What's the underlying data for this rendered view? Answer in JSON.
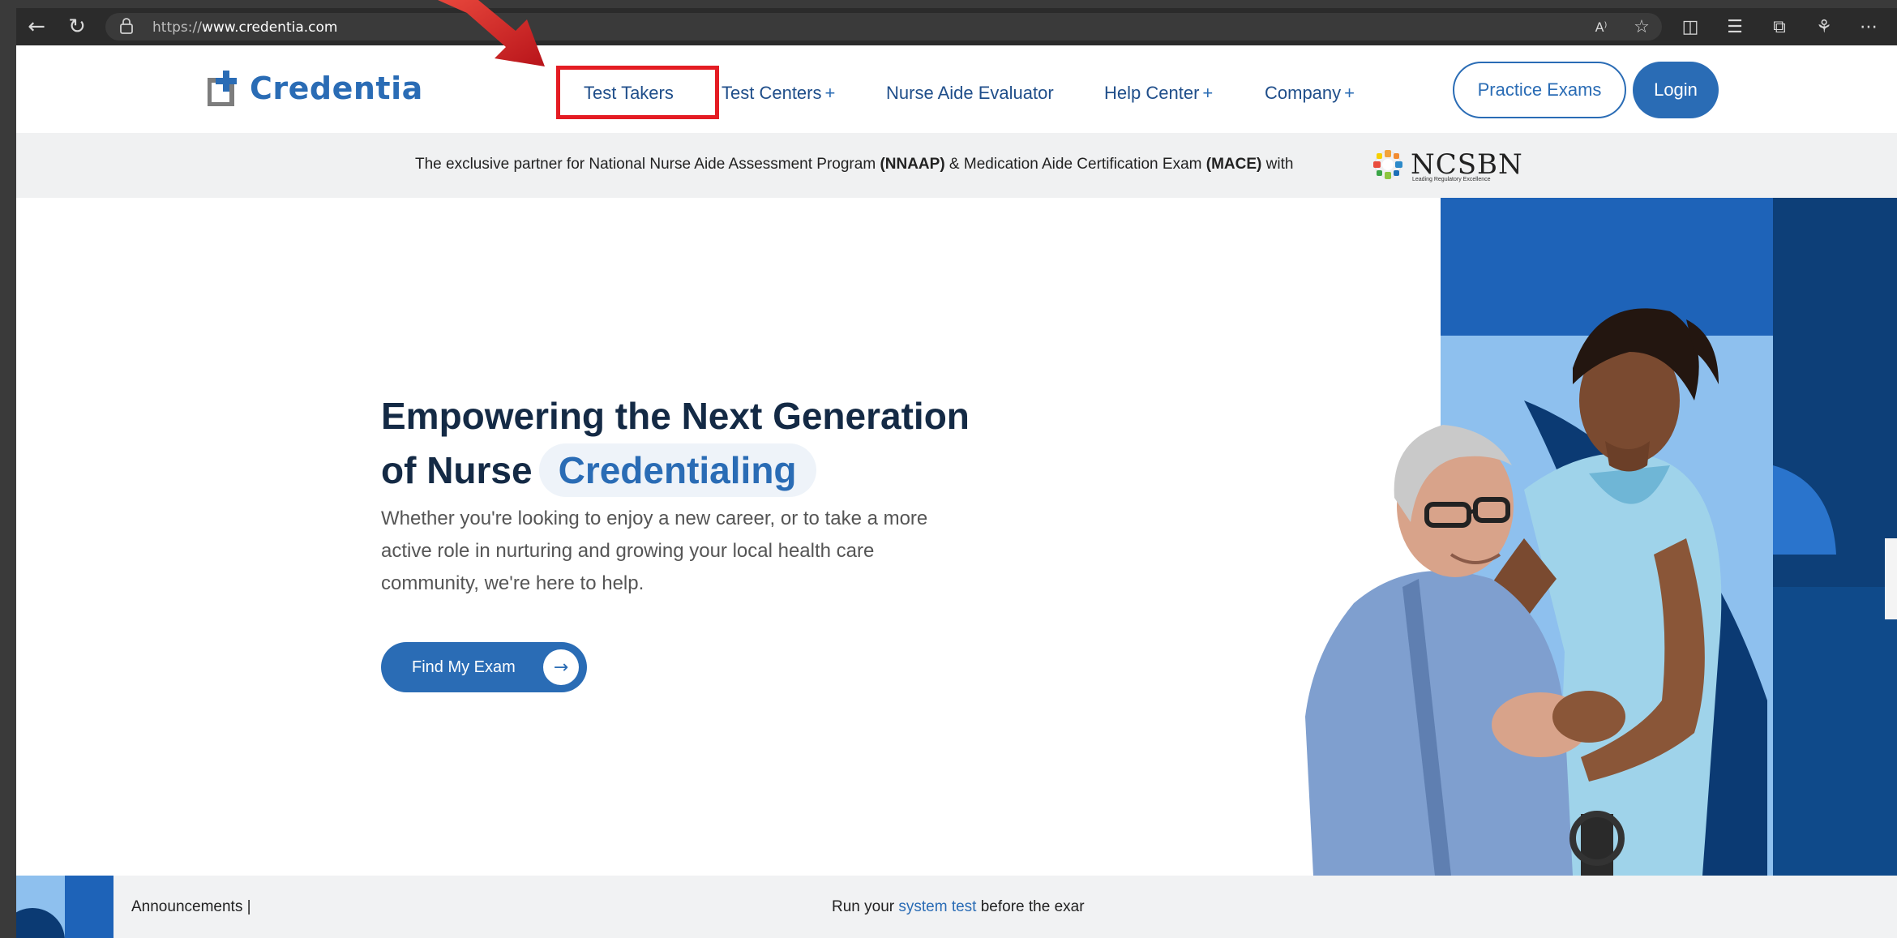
{
  "browser": {
    "url_scheme": "https://",
    "url_host": "www.credentia.com",
    "reader_label": "A⁾"
  },
  "site": {
    "logo_text": "Credentia",
    "nav": [
      {
        "label": "Test Takers",
        "plus": ""
      },
      {
        "label": "Test Centers",
        "plus": "+"
      },
      {
        "label": "Nurse Aide Evaluator",
        "plus": ""
      },
      {
        "label": "Help Center",
        "plus": "+"
      },
      {
        "label": "Company",
        "plus": "+"
      }
    ],
    "practice_label": "Practice Exams",
    "login_label": "Login"
  },
  "strip": {
    "text_1": "The exclusive partner for National Nurse Aide Assessment Program ",
    "bold_1": "(NNAAP)",
    "text_2": " & Medication Aide Certification Exam ",
    "bold_2": "(MACE)",
    "text_3": " with",
    "ncsbn_word": "NCSBN",
    "ncsbn_tagline": "Leading Regulatory Excellence"
  },
  "hero": {
    "title_line1": "Empowering the Next Generation",
    "title_line2_prefix": "of Nurse",
    "title_highlight": "Credentialing",
    "paragraph": "Whether you're looking to enjoy a new career, or to take a more active role in nurturing and growing your local health care community, we're here to help.",
    "cta_label": "Find My Exam",
    "cta_arrow": "→"
  },
  "bottom": {
    "announcements": "Announcements |",
    "run_prefix": "Run your ",
    "run_link": "system test",
    "run_suffix": " before the exar"
  },
  "colors": {
    "brand_blue": "#2a6cb5",
    "dark_navy": "#142a45",
    "highlight_red": "#e41c23"
  }
}
